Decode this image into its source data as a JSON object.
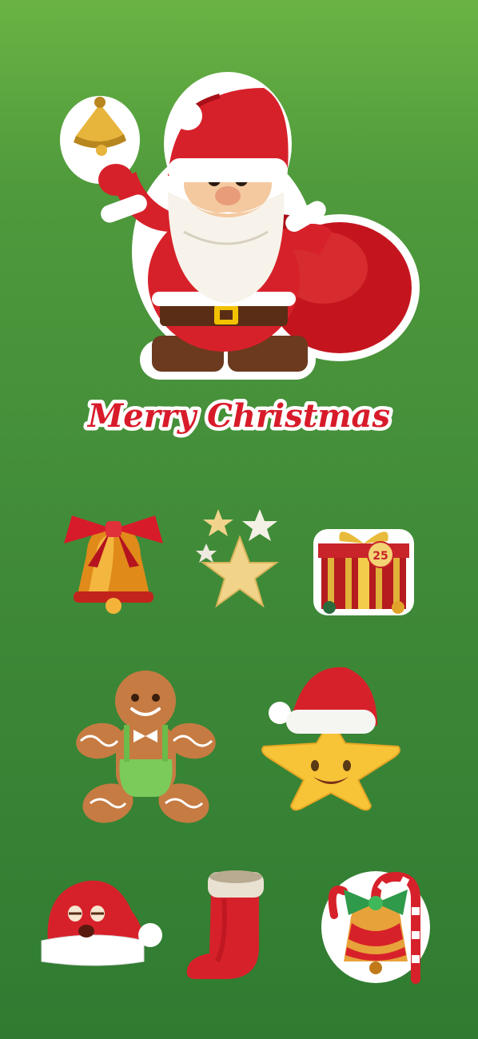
{
  "title": "Merry Christmas",
  "colors": {
    "background_top": "#6ab344",
    "background_bottom": "#2f7b31",
    "title_red": "#d81b2a",
    "santa_red": "#d7212a",
    "gold": "#e7b43c"
  },
  "stickers": [
    {
      "id": "santa",
      "icon": "santa-with-bell-and-sack-icon"
    },
    {
      "id": "bell",
      "icon": "bell-with-bow-icon"
    },
    {
      "id": "stars",
      "icon": "gold-stars-icon"
    },
    {
      "id": "gift",
      "icon": "gift-box-25-icon",
      "tag": "25"
    },
    {
      "id": "gingerbread",
      "icon": "gingerbread-man-icon"
    },
    {
      "id": "star-santa-hat",
      "icon": "smiling-star-with-santa-hat-icon"
    },
    {
      "id": "santa-hat-face",
      "icon": "sleepy-santa-hat-icon"
    },
    {
      "id": "stocking",
      "icon": "christmas-stocking-icon"
    },
    {
      "id": "candy-bell",
      "icon": "candy-cane-bell-icon"
    }
  ]
}
